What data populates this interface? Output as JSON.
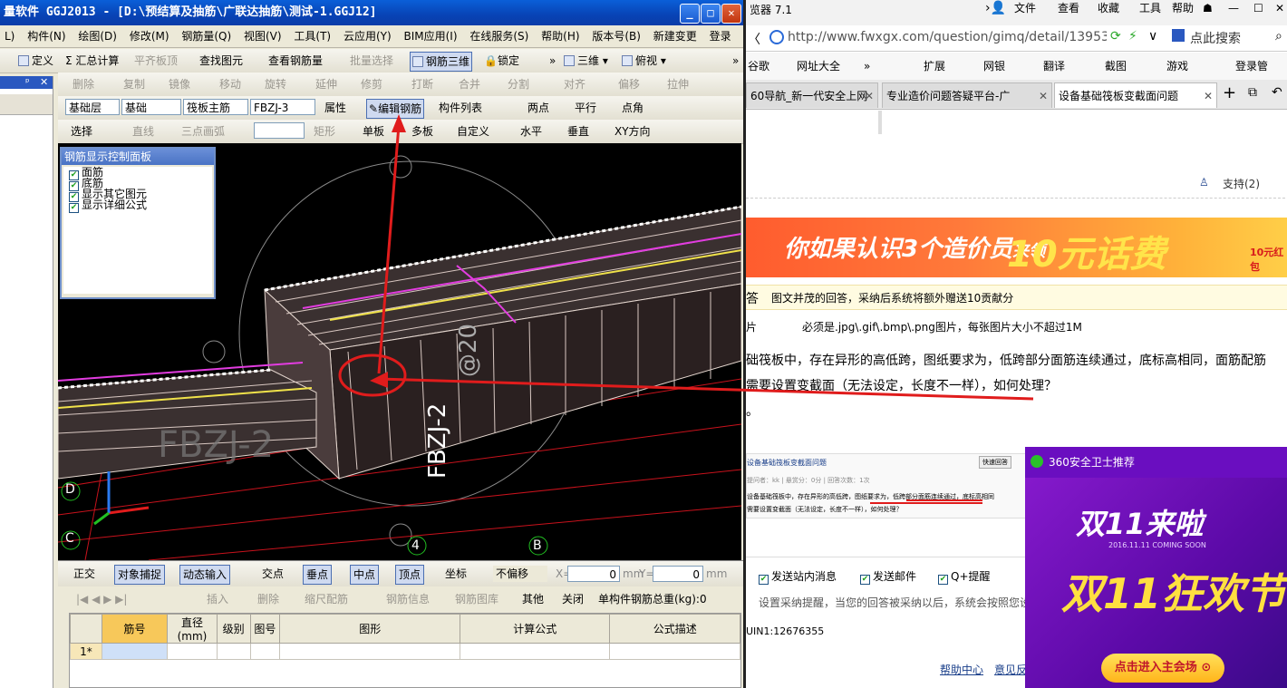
{
  "app": {
    "title": "量软件 GGJ2013 - [D:\\预结算及抽筋\\广联达抽筋\\测试-1.GGJ12]",
    "window_buttons": {
      "minimize": "_",
      "maximize": "□",
      "close": "✕"
    },
    "menu": [
      "L)",
      "构件(N)",
      "绘图(D)",
      "修改(M)",
      "钢筋量(Q)",
      "视图(V)",
      "工具(T)",
      "云应用(Y)",
      "BIM应用(I)",
      "在线服务(S)",
      "帮助(H)",
      "版本号(B)",
      "新建变更",
      "登录"
    ],
    "toolbar1": {
      "define": "定义",
      "summary": "Σ 汇总计算",
      "flat_board": "平齐板顶",
      "find": "查找图元",
      "view_rebar_qty": "查看钢筋量",
      "batch_select": "批量选择",
      "rebar_3d": "钢筋三维",
      "lock": "锁定",
      "view_3d": "三维",
      "top_view": "俯视"
    },
    "toolbar2": {
      "delete": "删除",
      "copy": "复制",
      "mirror": "镜像",
      "move": "移动",
      "rotate": "旋转",
      "extend": "延伸",
      "trim": "修剪",
      "break": "打断",
      "merge": "合并",
      "split": "分割",
      "align": "对齐",
      "offset": "偏移",
      "stretch": "拉伸"
    },
    "toolbar3": {
      "layer": "基础层",
      "category": "基础",
      "type": "筏板主筋",
      "name": "FBZJ-3",
      "property": "属性",
      "edit_rebar": "编辑钢筋",
      "component_list": "构件列表",
      "two_points": "两点",
      "parallel": "平行",
      "point_angle": "点角"
    },
    "toolbar4": {
      "select": "选择",
      "line": "直线",
      "arc": "三点画弧",
      "rect": "矩形",
      "single_board": "单板",
      "multi_board": "多板",
      "custom": "自定义",
      "horizontal": "水平",
      "vertical": "垂直",
      "xy_dir": "XY方向"
    },
    "control_panel": {
      "title": "钢筋显示控制面板",
      "items": [
        "面筋",
        "底筋",
        "显示其它图元",
        "显示详细公式"
      ]
    },
    "viewport": {
      "watermark_vertical": "FBZJ-2",
      "watermark_vertical2": "@20",
      "watermark_horizontal": "FBZJ-2",
      "axis_labels": [
        "D",
        "C",
        "4",
        "B"
      ]
    },
    "snapbar": {
      "ortho": "正交",
      "object_snap": "对象捕捉",
      "dynamic_input": "动态输入",
      "intersection": "交点",
      "perpendicular": "垂点",
      "midpoint": "中点",
      "vertex": "顶点",
      "coordinate": "坐标",
      "offset_mode": "不偏移",
      "x_label": "X=",
      "x_value": "0",
      "y_label": "Y=",
      "y_value": "0",
      "unit": "mm"
    },
    "grid_toolbar": {
      "insert": "插入",
      "delete": "删除",
      "scale_rebar": "缩尺配筋",
      "rebar_info": "钢筋信息",
      "rebar_library": "钢筋图库",
      "other": "其他",
      "close": "关闭",
      "total_weight": "单构件钢筋总重(kg):0"
    },
    "grid": {
      "columns": [
        "筋号",
        "直径(mm)",
        "级别",
        "图号",
        "图形",
        "计算公式",
        "公式描述"
      ],
      "rows": [
        {
          "index": "1*",
          "cells": [
            "",
            "",
            "",
            "",
            "",
            "",
            ""
          ]
        }
      ]
    }
  },
  "browser": {
    "title": "览器 7.1",
    "menu": [
      "文件",
      "查看",
      "收藏",
      "工具",
      "帮助"
    ],
    "url": "http://www.fwxgx.com/question/gimq/detail/1395388",
    "search_placeholder": "点此搜索",
    "bookmarks": [
      "谷歌",
      "网址大全",
      "扩展",
      "网银",
      "翻译",
      "截图",
      "游戏",
      "登录管"
    ],
    "tabs": [
      {
        "label": "60导航_新一代安全上网",
        "active": false
      },
      {
        "label": "专业造价问题答疑平台-广",
        "active": false
      },
      {
        "label": "设备基础筏板变截面问题",
        "active": true
      }
    ],
    "support": "支持(2)",
    "banner": {
      "text1": "你如果认识3个造价员",
      "text1b": "来领",
      "text2": "10元话费",
      "badge": "10元红包"
    },
    "answer_label": "答",
    "answer_note": "图文并茂的回答，采纳后系统将额外赠送10贡献分",
    "image_label": "片",
    "image_note": "必须是.jpg\\.gif\\.bmp\\.png图片，每张图片大小不超过1M",
    "question_line1": "础筏板中，存在异形的高低跨，图纸要求为，低跨部分面筋连续通过，底标高相同，面筋配筋",
    "question_line2": "需要设置变截面（无法设定，长度不一样），如何处理？",
    "question_line3": "。",
    "thumbnail": {
      "title": "设备基础筏板变截面问题",
      "meta": "提问者：kk  |  悬赏分：0分  |  回答次数：1次",
      "reply_button": "快速回答",
      "text1": "设备基础筏板中，存在异形的高低跨，图纸要求为，低跨部分面筋连续通过，底标高相同",
      "text2": "需要设置变截面（无法设定，长度不一样），如何处理？"
    },
    "options": [
      "发送站内消息",
      "发送邮件",
      "Q+提醒"
    ],
    "option_note": "设置采纳提醒，当您的回答被采纳以后，系统会按照您设",
    "uin": "UIN1:12676355",
    "footer": [
      "帮助中心",
      "意见反"
    ],
    "popup": {
      "header": "360安全卫士推荐",
      "big1": "双11来啦",
      "small": "2016.11.11   COMING SOON",
      "big2": "双11狂欢节",
      "cta": "点击进入主会场"
    }
  }
}
